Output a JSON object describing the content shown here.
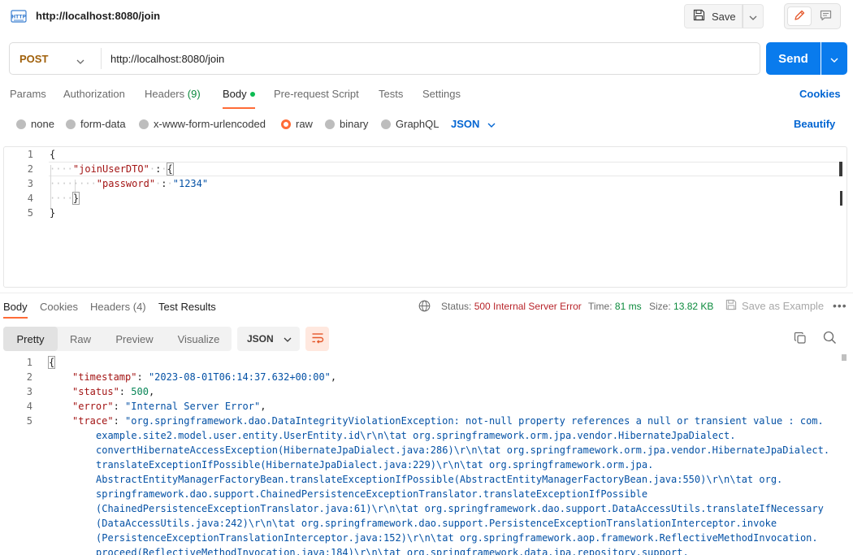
{
  "request": {
    "title": "http://localhost:8080/join",
    "save_label": "Save",
    "method": "POST",
    "url": "http://localhost:8080/join",
    "send_label": "Send"
  },
  "request_tabs": {
    "params": "Params",
    "authorization": "Authorization",
    "headers": "Headers",
    "headers_count": "(9)",
    "body": "Body",
    "pre_request": "Pre-request Script",
    "tests": "Tests",
    "settings": "Settings",
    "cookies": "Cookies"
  },
  "body_types": {
    "none": "none",
    "form_data": "form-data",
    "urlencoded": "x-www-form-urlencoded",
    "raw": "raw",
    "binary": "binary",
    "graphql": "GraphQL",
    "selected_format": "JSON",
    "beautify": "Beautify"
  },
  "request_body": {
    "line_numbers": [
      "1",
      "2",
      "3",
      "4",
      "5"
    ],
    "key_join_user": "\"joinUserDTO\"",
    "key_password": "\"password\"",
    "val_password": "\"1234\"",
    "open_brace": "{",
    "close_brace": "}",
    "colon": ":"
  },
  "response_tabs": {
    "body": "Body",
    "cookies": "Cookies",
    "headers": "Headers (4)",
    "test_results": "Test Results",
    "status_label": "Status:",
    "status_value": "500 Internal Server Error",
    "time_label": "Time:",
    "time_value": "81 ms",
    "size_label": "Size:",
    "size_value": "13.82 KB",
    "save_example": "Save as Example"
  },
  "response_view": {
    "modes": [
      "Pretty",
      "Raw",
      "Preview",
      "Visualize"
    ],
    "format": "JSON"
  },
  "response_body": {
    "line_numbers": [
      "1",
      "2",
      "3",
      "4",
      "5"
    ],
    "open_brace": "{",
    "timestamp_key": "\"timestamp\"",
    "timestamp_val": "\"2023-08-01T06:14:37.632+00:00\"",
    "status_key": "\"status\"",
    "status_val": "500",
    "error_key": "\"error\"",
    "error_val": "\"Internal Server Error\"",
    "trace_key": "\"trace\"",
    "trace_lines": [
      "\"org.springframework.dao.DataIntegrityViolationException: not-null property references a null or transient value : com.",
      "example.site2.model.user.entity.UserEntity.id\\r\\n\\tat org.springframework.orm.jpa.vendor.HibernateJpaDialect.",
      "convertHibernateAccessException(HibernateJpaDialect.java:286)\\r\\n\\tat org.springframework.orm.jpa.vendor.HibernateJpaDialect.",
      "translateExceptionIfPossible(HibernateJpaDialect.java:229)\\r\\n\\tat org.springframework.orm.jpa.",
      "AbstractEntityManagerFactoryBean.translateExceptionIfPossible(AbstractEntityManagerFactoryBean.java:550)\\r\\n\\tat org.",
      "springframework.dao.support.ChainedPersistenceExceptionTranslator.translateExceptionIfPossible",
      "(ChainedPersistenceExceptionTranslator.java:61)\\r\\n\\tat org.springframework.dao.support.DataAccessUtils.translateIfNecessary",
      "(DataAccessUtils.java:242)\\r\\n\\tat org.springframework.dao.support.PersistenceExceptionTranslationInterceptor.invoke",
      "(PersistenceExceptionTranslationInterceptor.java:152)\\r\\n\\tat org.springframework.aop.framework.ReflectiveMethodInvocation.",
      "proceed(ReflectiveMethodInvocation.java:184)\\r\\n\\tat org.springframework.data.jpa.repository.support."
    ]
  },
  "colors": {
    "accent_orange": "#ff6c37",
    "send_blue": "#097bed",
    "link_blue": "#0265d2",
    "method_post": "#a0600a",
    "status_error": "#b8242a",
    "status_ok": "#0b8a3c",
    "json_key": "#a31515",
    "json_string": "#0451a5",
    "json_number": "#098658"
  },
  "icons": {
    "request_type": "http-icon",
    "save": "save-icon",
    "edit": "pencil-icon",
    "comments": "comment-icon",
    "globe": "globe-icon",
    "wrap": "wrap-lines-icon",
    "copy": "copy-icon",
    "search": "search-icon"
  }
}
